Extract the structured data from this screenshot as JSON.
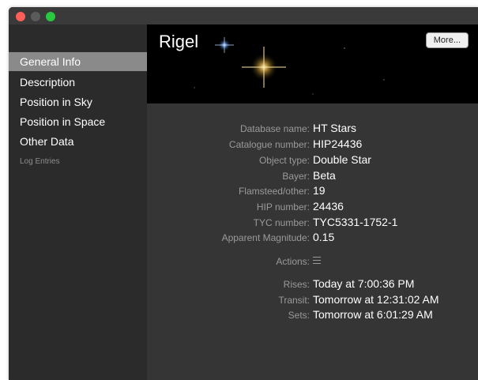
{
  "sidebar": {
    "items": [
      {
        "label": "General Info",
        "selected": true
      },
      {
        "label": "Description",
        "selected": false
      },
      {
        "label": "Position in Sky",
        "selected": false
      },
      {
        "label": "Position in Space",
        "selected": false
      },
      {
        "label": "Other Data",
        "selected": false
      }
    ],
    "log_entries": "Log Entries"
  },
  "header": {
    "title": "Rigel",
    "more_label": "More..."
  },
  "info": [
    {
      "label": "Database name:",
      "value": "HT Stars"
    },
    {
      "label": "Catalogue number:",
      "value": "HIP24436"
    },
    {
      "label": "Object type:",
      "value": "Double Star"
    },
    {
      "label": "Bayer:",
      "value": "Beta"
    },
    {
      "label": "Flamsteed/other:",
      "value": "19"
    },
    {
      "label": "HIP number:",
      "value": "24436"
    },
    {
      "label": "TYC number:",
      "value": "TYC5331-1752-1"
    },
    {
      "label": "Apparent Magnitude:",
      "value": "0.15"
    }
  ],
  "actions": {
    "label": "Actions:",
    "icon": "hamburger-menu-icon"
  },
  "times": [
    {
      "label": "Rises:",
      "value": "Today at 7:00:36 PM"
    },
    {
      "label": "Transit:",
      "value": "Tomorrow at 12:31:02 AM"
    },
    {
      "label": "Sets:",
      "value": "Tomorrow at 6:01:29 AM"
    }
  ],
  "colors": {
    "close": "#fc5f57",
    "minimize": "#5b5b5b",
    "zoom": "#29c840",
    "selection": "#8a8a8a"
  }
}
